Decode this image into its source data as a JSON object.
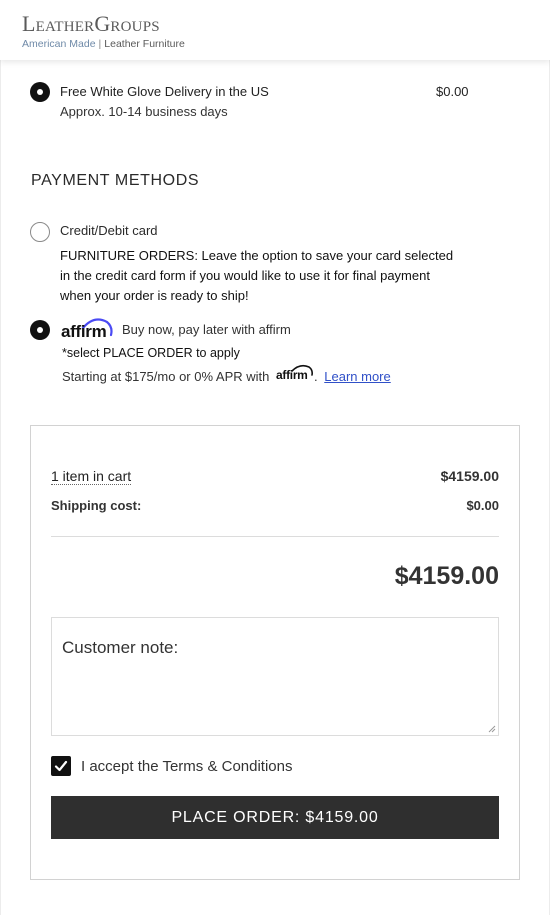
{
  "header": {
    "logo_main": "LeatherGroups",
    "logo_sub_a": "American Made",
    "logo_sub_sep": "|",
    "logo_sub_b": "Leather Furniture"
  },
  "shipping": {
    "option_name": "Free White Glove Delivery in the US",
    "option_days": "Approx. 10-14 business days",
    "option_price": "$0.00",
    "selected": true
  },
  "payment": {
    "title": "PAYMENT METHODS",
    "credit_label": "Credit/Debit card",
    "credit_note_lines": [
      "FURNITURE ORDERS: Leave the option to save your card selected",
      "in the credit card form if you would like to use it for final payment",
      "when your order is ready to ship!"
    ],
    "affirm_logo": "affirm",
    "affirm_desc": "Buy now, pay later with affirm",
    "affirm_apply": "*select PLACE ORDER to apply",
    "affirm_starting": "Starting at $175/mo or 0% APR with",
    "affirm_inline_logo": "affirm",
    "affirm_period": ".",
    "learn_more": "Learn more",
    "affirm_selected": true
  },
  "cart": {
    "items_label": "1 item in cart",
    "items_total": "$4159.00",
    "shipping_label": "Shipping cost:",
    "shipping_value": "$0.00",
    "grand_total": "$4159.00",
    "note_label": "Customer note:",
    "note_value": "",
    "terms_label": "I accept the Terms & Conditions",
    "terms_checked": true,
    "place_order_label": "PLACE ORDER: $4159.00"
  },
  "colors": {
    "button_bg": "#2f2f2f",
    "affirm_arc": "#4a4af4",
    "link": "#3050c8",
    "logo_sub_accent": "#6f8aa8"
  }
}
